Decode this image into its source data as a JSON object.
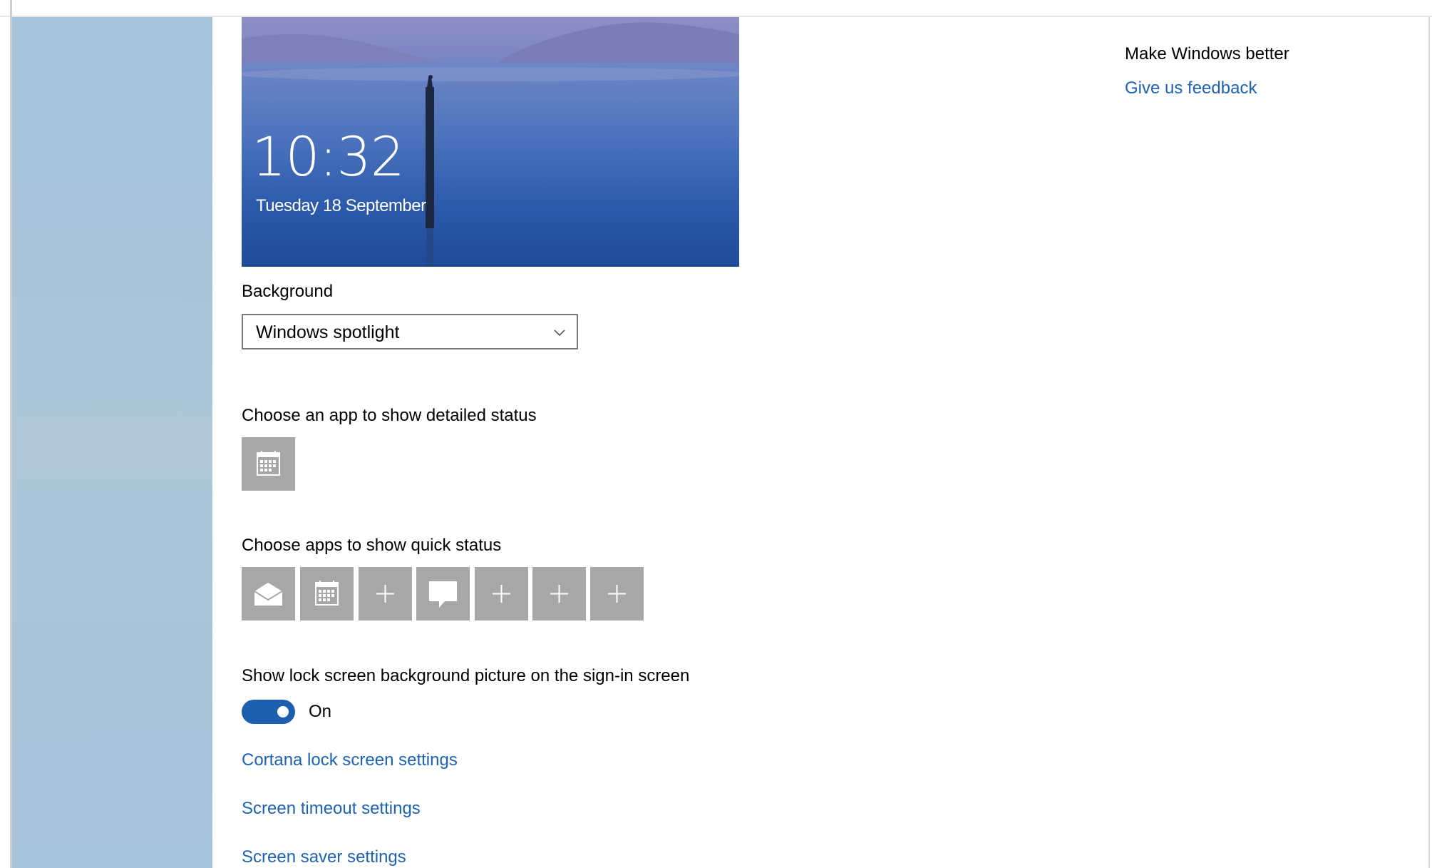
{
  "preview": {
    "time": "10:32",
    "date": "Tuesday 18 September"
  },
  "background": {
    "label": "Background",
    "selected": "Windows spotlight"
  },
  "detailed_status": {
    "label": "Choose an app to show detailed status",
    "app_icon": "calendar-icon"
  },
  "quick_status": {
    "label": "Choose apps to show quick status",
    "tiles": [
      "mail-icon",
      "calendar-icon",
      "plus-icon",
      "message-icon",
      "plus-icon",
      "plus-icon",
      "plus-icon"
    ]
  },
  "signin_background": {
    "label": "Show lock screen background picture on the sign-in screen",
    "state_label": "On",
    "enabled": true
  },
  "links": {
    "cortana": "Cortana lock screen settings",
    "timeout": "Screen timeout settings",
    "screensaver": "Screen saver settings"
  },
  "feedback": {
    "title": "Make Windows better",
    "link": "Give us feedback"
  },
  "colors": {
    "accent": "#1d62b5",
    "toggle_on": "#1b5fae",
    "tile_bg": "#a7a7a7"
  }
}
